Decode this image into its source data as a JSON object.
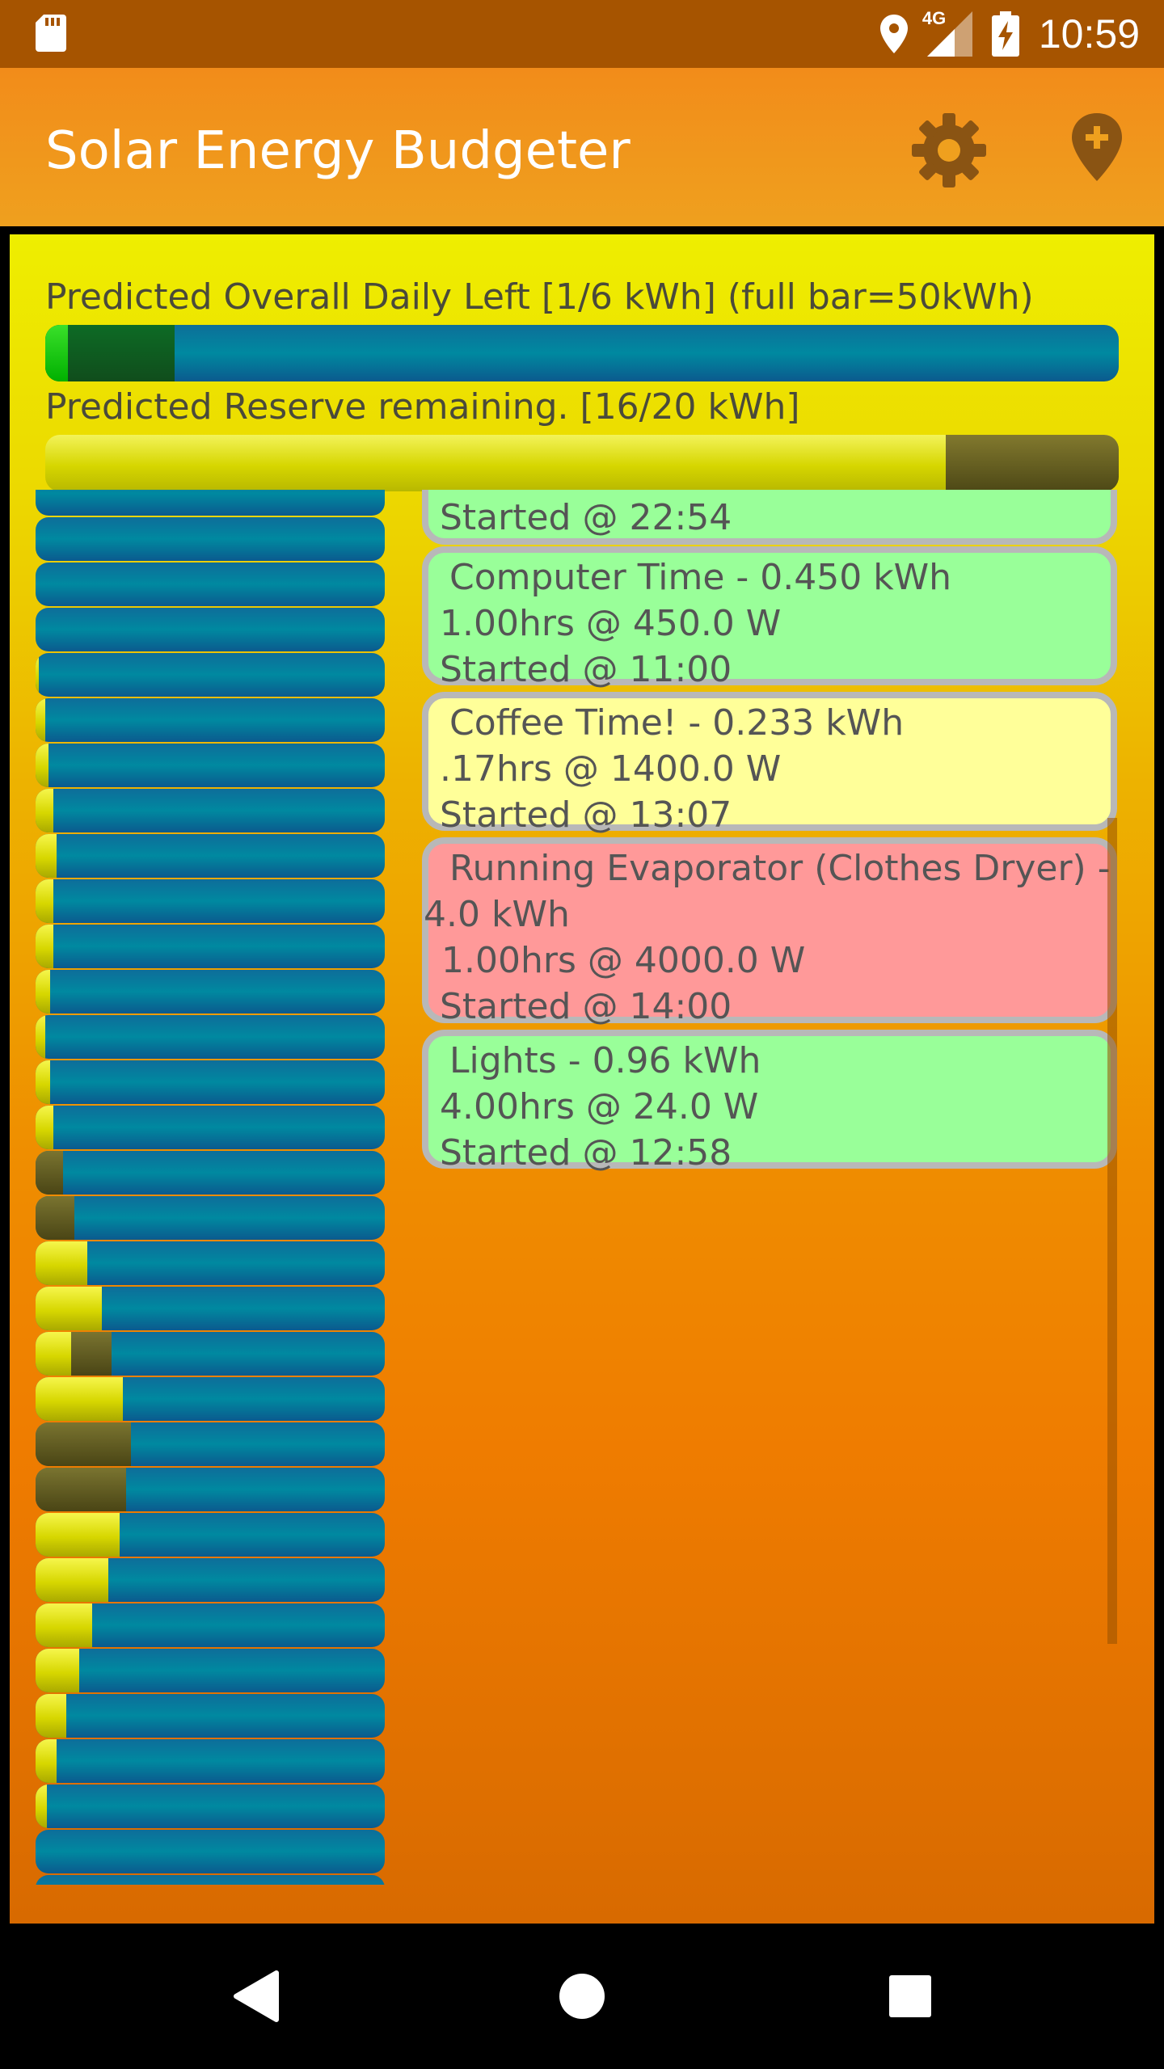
{
  "status_bar": {
    "network": "4G",
    "time": "10:59"
  },
  "app_bar": {
    "title": "Solar Energy Budgeter",
    "settings_icon": "gear-icon",
    "add_location_icon": "add-location-pin-icon"
  },
  "overview": {
    "daily_label": "Predicted Overall Daily Left [1/6 kWh] (full bar=50kWh)",
    "daily_used_fraction": 0.02,
    "daily_projected_fraction": 0.12,
    "reserve_label": "Predicted Reserve remaining. [16/20 kWh]",
    "reserve_fraction": 0.84
  },
  "tasks": [
    {
      "lines": [
        "Started @ 22:54"
      ],
      "status": "green",
      "partial": true
    },
    {
      "title": "Computer Time - 0.450 kWh",
      "lines": [
        "1.00hrs @ 450.0 W",
        "Started @ 11:00"
      ],
      "status": "green"
    },
    {
      "title": "Coffee Time! - 0.233 kWh",
      "lines": [
        ".17hrs @ 1400.0 W",
        "Started @ 13:07"
      ],
      "status": "yellow"
    },
    {
      "title": "Running Evaporator (Clothes Dryer) -",
      "title2": "4.0 kWh",
      "lines": [
        "1.00hrs @ 4000.0 W",
        "Started @ 14:00"
      ],
      "status": "red"
    },
    {
      "title": "Lights - 0.96 kWh",
      "lines": [
        "4.00hrs @ 24.0 W",
        "Started @ 12:58"
      ],
      "status": "green"
    }
  ],
  "colors": {
    "status_bar": "#a65400",
    "app_bar": "#f28c1a",
    "task_green": "#99ff99",
    "task_yellow": "#ffff99",
    "task_red": "#ff9999"
  }
}
